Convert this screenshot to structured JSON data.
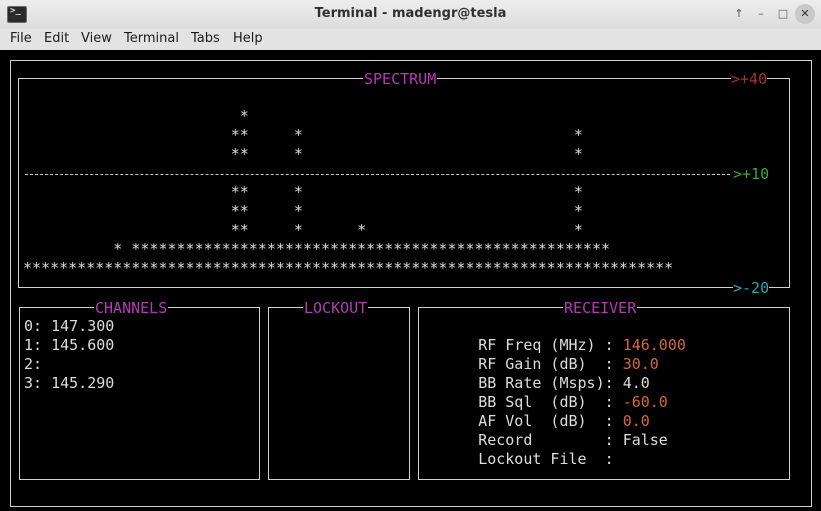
{
  "window": {
    "title": "Terminal - madengr@tesla",
    "controls": [
      "↑",
      "–",
      "□",
      "✕"
    ]
  },
  "menubar": {
    "items": [
      "File",
      "Edit",
      "View",
      "Terminal",
      "Tabs",
      "Help"
    ]
  },
  "spectrum": {
    "title": "SPECTRUM",
    "scale_top": ">+40",
    "scale_mid": ">+10",
    "scale_bottom": ">-20",
    "rows": [
      "                        *",
      "                       **     *                              *",
      "                       **     *                              *",
      "                       **     *                              *",
      "                       **     *                              *",
      "                       **     *      *                       *",
      "          * *****************************************************",
      "************************************************************************"
    ]
  },
  "channels": {
    "title": "CHANNELS",
    "items": [
      "0: 147.300",
      "1: 145.600",
      "2:",
      "3: 145.290"
    ]
  },
  "lockout": {
    "title": "LOCKOUT"
  },
  "receiver": {
    "title": "RECEIVER",
    "rows": [
      {
        "label": "RF Freq (MHz) : ",
        "value": "146.000",
        "color": "#d2693a"
      },
      {
        "label": "RF Gain (dB)  : ",
        "value": "30.0",
        "color": "#d2693a"
      },
      {
        "label": "BB Rate (Msps): ",
        "value": "4.0",
        "color": "#dcdcdc"
      },
      {
        "label": "BB Sql  (dB)  : ",
        "value": "-60.0",
        "color": "#d2693a"
      },
      {
        "label": "AF Vol  (dB)  : ",
        "value": "0.0",
        "color": "#d2693a"
      },
      {
        "label": "Record        : ",
        "value": "False",
        "color": "#dcdcdc"
      },
      {
        "label": "Lockout File  : ",
        "value": "",
        "color": "#dcdcdc"
      }
    ]
  },
  "colors": {
    "title_magenta": "#b43bb4",
    "scale_red": "#a83232",
    "scale_green": "#3aa83a",
    "scale_cyan": "#2aa7b8",
    "value_orange": "#d2693a"
  }
}
